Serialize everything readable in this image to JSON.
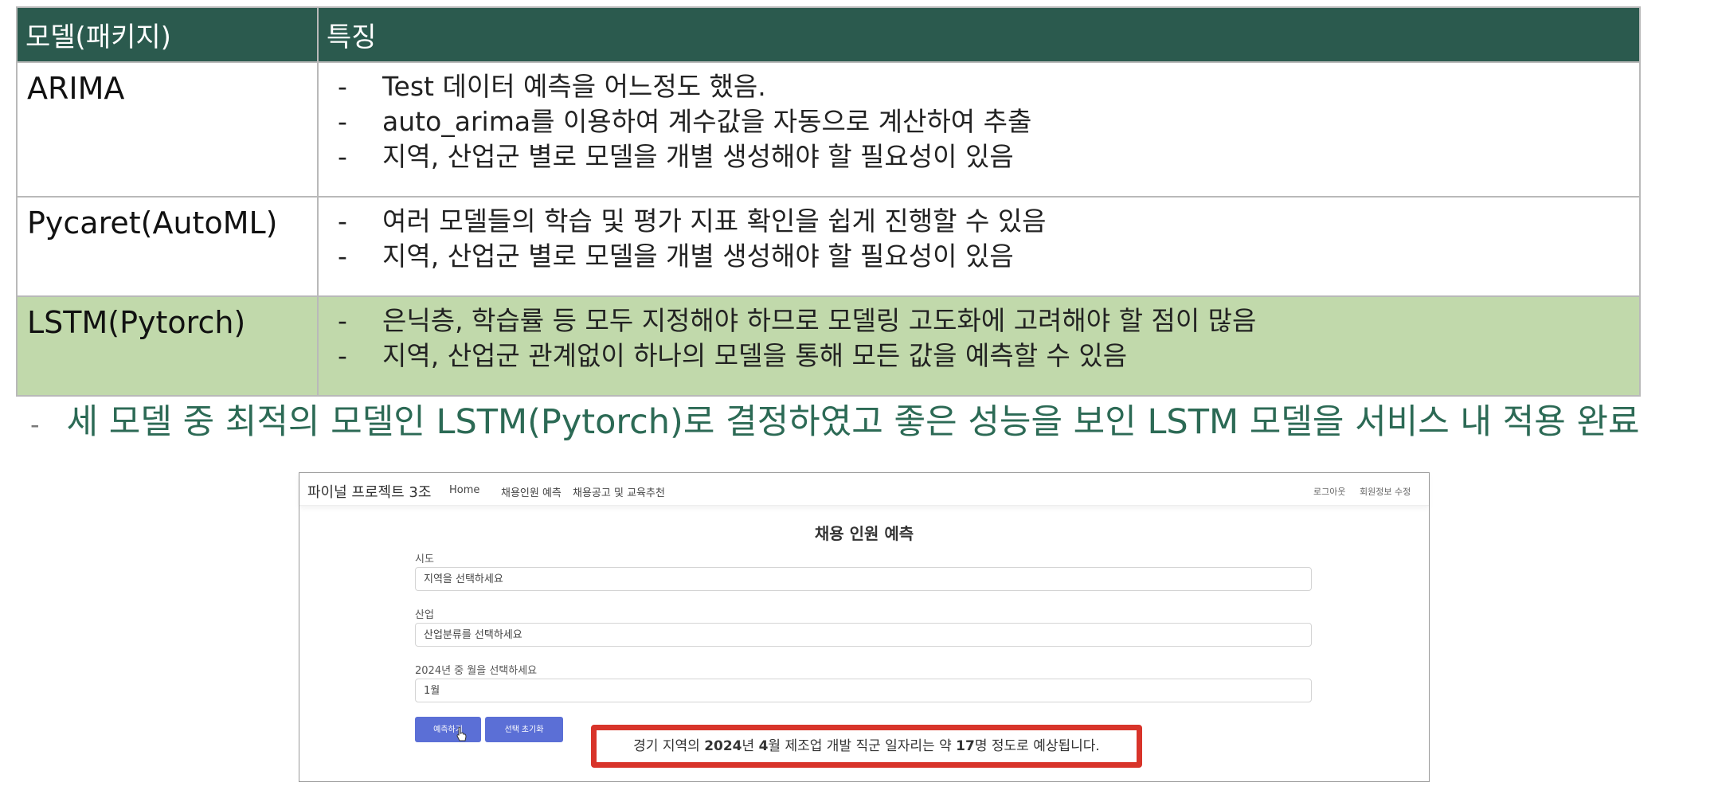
{
  "table": {
    "headers": [
      "모델(패키지)",
      "특징"
    ],
    "rows": [
      {
        "model": "ARIMA",
        "features": [
          "Test 데이터 예측을 어느정도 했음.",
          "auto_arima를 이용하여 계수값을 자동으로 계산하여 추출",
          "지역, 산업군 별로 모델을 개별 생성해야 할 필요성이 있음"
        ]
      },
      {
        "model": "Pycaret(AutoML)",
        "features": [
          "여러 모델들의 학습 및 평가 지표 확인을 쉽게 진행할 수 있음",
          "지역, 산업군 별로 모델을 개별 생성해야 할 필요성이 있음"
        ]
      },
      {
        "model": "LSTM(Pytorch)",
        "features": [
          "은닉층, 학습률 등 모두 지정해야 하므로 모델링 고도화에 고려해야 할 점이 많음",
          "지역, 산업군 관계없이 하나의 모델을 통해 모든 값을 예측할 수 있음"
        ]
      }
    ],
    "colors": {
      "header_bg": "#2b5a4e",
      "header_text": "#ffffff",
      "highlight_row_bg": "#c1d9ab"
    }
  },
  "conclusion": {
    "bullet": "-",
    "text": "세 모델 중 최적의 모델인 LSTM(Pytorch)로 결정하였고 좋은 성능을 보인 LSTM 모델을 서비스 내 적용 완료",
    "color": "#2c6a55"
  },
  "app": {
    "brand": "파이널 프로젝트 3조",
    "nav_links": [
      "Home",
      "채용인원 예측",
      "채용공고 및 교육추천"
    ],
    "nav_right": [
      "로그아웃",
      "회원정보 수정"
    ],
    "title": "채용 인원 예측",
    "fields": [
      {
        "label": "시도",
        "value": "지역을 선택하세요"
      },
      {
        "label": "산업",
        "value": "산업분류를 선택하세요"
      },
      {
        "label": "2024년 중 월을 선택하세요",
        "value": "1월"
      }
    ],
    "buttons": {
      "predict": "예측하기",
      "reset": "선택 초기화"
    },
    "button_color": "#5b6fd6",
    "result": {
      "part1": "경기 지역의 ",
      "year": "2024",
      "part2": "년 ",
      "month": "4",
      "part3": "월 제조업 개발 직군 일자리는 약 ",
      "count": "17",
      "part4": "명 정도로 예상됩니다.",
      "border_color": "#d8342a"
    }
  }
}
